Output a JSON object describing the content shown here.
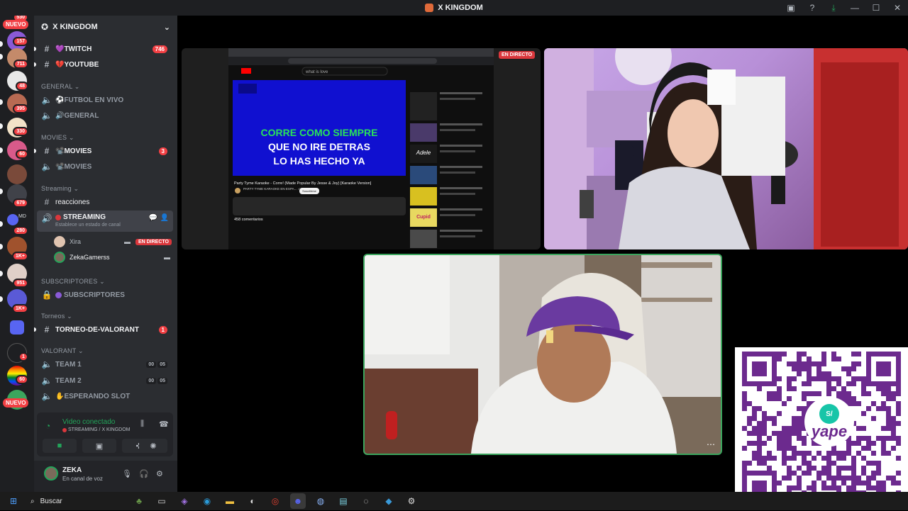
{
  "window": {
    "title": "X KINGDOM"
  },
  "server": {
    "name": "X KINGDOM"
  },
  "rail": {
    "badges": [
      "157",
      "711",
      "48",
      "395",
      "330",
      "60",
      "679",
      "280",
      "1K+",
      "951",
      "1K+",
      "1",
      "60"
    ],
    "nuevo_top": "NUEVO",
    "nuevo_bottom": "NUEVO",
    "top_badge": "530",
    "md_label": "MD"
  },
  "channels": {
    "top": [
      {
        "name": "💜TWITCH",
        "count": "746"
      },
      {
        "name": "💔YOUTUBE",
        "count": ""
      }
    ],
    "categories": {
      "general": "GENERAL",
      "movies": "MOVIES",
      "streaming": "Streaming",
      "subs": "SUBSCRIPTORES",
      "torneos": "Torneos",
      "valorant": "VALORANT"
    },
    "general": [
      {
        "name": "⚽FUTBOL EN VIVO"
      },
      {
        "name": "🔊GENERAL"
      }
    ],
    "movies": [
      {
        "name": "📽️MOVIES",
        "count": "3"
      },
      {
        "name": "📽️MOVIES"
      }
    ],
    "streaming_text": "reacciones",
    "streaming_voice": {
      "name": "STREAMING",
      "status": "Establece un estado de canal"
    },
    "voice_users": [
      {
        "name": "Xira",
        "live": "EN DIRECTO"
      },
      {
        "name": "ZekaGamerss"
      }
    ],
    "subs_channel": "SUBSCRIPTORES",
    "torneo_channel": {
      "name": "TORNEO-DE-VALORANT",
      "count": "1"
    },
    "valorant": [
      {
        "name": "TEAM 1",
        "a": "00",
        "b": "05"
      },
      {
        "name": "TEAM 2",
        "a": "00",
        "b": "05"
      },
      {
        "name": "✋ESPERANDO SLOT"
      }
    ]
  },
  "voice_panel": {
    "status": "Video conectado",
    "location": "STREAMING / X KINGDOM"
  },
  "user_panel": {
    "name": "ZEKA",
    "status": "En canal de voz"
  },
  "stream": {
    "live_badge": "EN DIRECTO",
    "karaoke_lines": [
      "CORRE COMO SIEMPRE",
      "QUE NO IRE DETRAS",
      "LO HAS HECHO YA"
    ],
    "video_title": "Party Tyme Karaoke - Corre! (Made Popular By Jesse & Joy) [Karaoke Version]",
    "channel": "PARTY TYME KARAOKE EN ESPA... ✓",
    "subscribe": "Suscribirse",
    "comments": "458 comentarios",
    "search_query": "what is love",
    "adele": "Adele",
    "cupid": "Cupid"
  },
  "qr": {
    "brand": "yape",
    "symbol": "S/"
  },
  "taskbar": {
    "search": "Buscar"
  },
  "colors": {
    "accent": "#5865f2",
    "live_red": "#da373c",
    "voice_green": "#23a55a",
    "yape": "#6c2a8e"
  }
}
